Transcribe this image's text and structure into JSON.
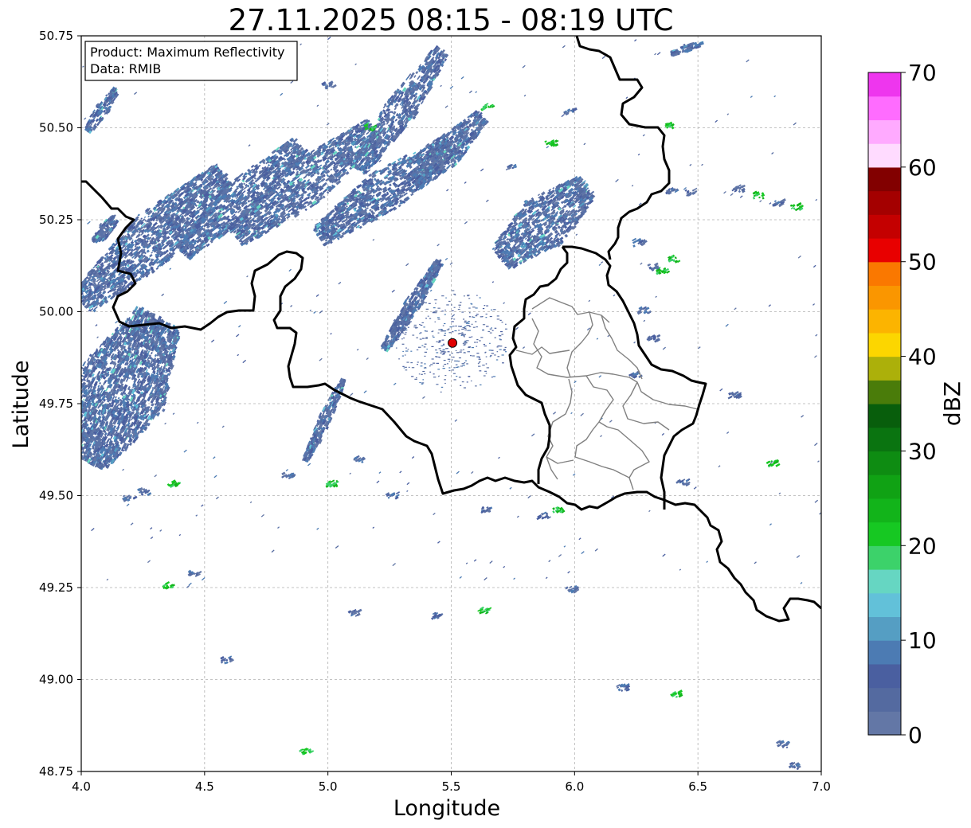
{
  "title": "27.11.2025 08:15 - 08:19 UTC",
  "info_box": {
    "product_line": "Product: Maximum Reflectivity",
    "data_line": "Data: RMIB"
  },
  "axes": {
    "xlabel": "Longitude",
    "ylabel": "Latitude",
    "xlim": [
      4.0,
      7.0
    ],
    "ylim": [
      48.75,
      50.75
    ],
    "xticks": [
      4.0,
      4.5,
      5.0,
      5.5,
      6.0,
      6.5,
      7.0
    ],
    "yticks": [
      48.75,
      49.0,
      49.25,
      49.5,
      49.75,
      50.0,
      50.25,
      50.5,
      50.75
    ],
    "xtick_labels": [
      "4.0",
      "4.5",
      "5.0",
      "5.5",
      "6.0",
      "6.5",
      "7.0"
    ],
    "ytick_labels": [
      "48.75",
      "49.00",
      "49.25",
      "49.50",
      "49.75",
      "50.00",
      "50.25",
      "50.50",
      "50.75"
    ],
    "grid": true
  },
  "colorbar": {
    "unit": "dBZ",
    "range": [
      0,
      70
    ],
    "tick_values": [
      0,
      10,
      20,
      30,
      40,
      50,
      60,
      70
    ],
    "tick_labels": [
      "0",
      "10",
      "20",
      "30",
      "40",
      "50",
      "60",
      "70"
    ],
    "colors": [
      "#6377a6",
      "#546aa0",
      "#4a5fa0",
      "#4c7bb3",
      "#559ec3",
      "#62c1d9",
      "#66d6c2",
      "#3cd26a",
      "#16c822",
      "#12b41a",
      "#10a214",
      "#0e8c12",
      "#0a7410",
      "#085e0c",
      "#4a7c0a",
      "#acb00a",
      "#fcd600",
      "#fcb400",
      "#fa9600",
      "#fa7800",
      "#e80000",
      "#c40000",
      "#a40000",
      "#820000",
      "#ffdbff",
      "#ffaaff",
      "#ff6cff",
      "#ee36ee"
    ]
  },
  "radar_site": {
    "lon": 5.505,
    "lat": 49.915,
    "color": "#e00000"
  },
  "colors": {
    "border_major": "#000000",
    "border_minor": "#808080",
    "grid": "#b0b0b0"
  }
}
